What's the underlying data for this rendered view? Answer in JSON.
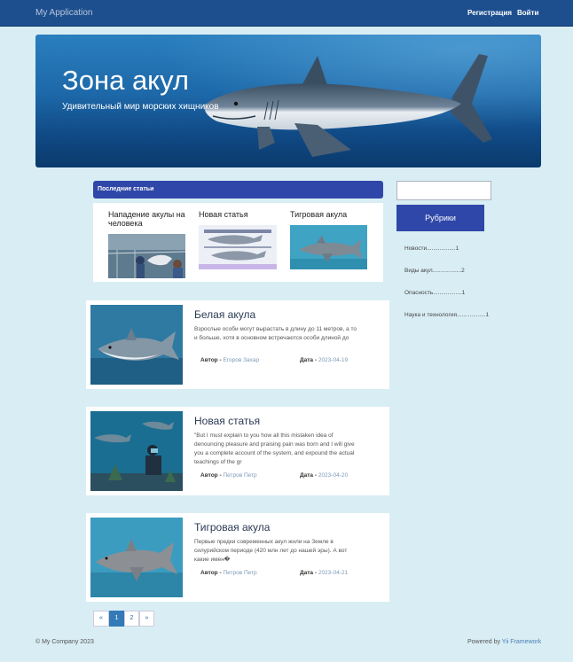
{
  "navbar": {
    "brand": "My Application",
    "register": "Регистрация",
    "login": "Войти"
  },
  "hero": {
    "title": "Зона акул",
    "subtitle": "Удивительный мир морских хищников"
  },
  "latest": {
    "header": "Последние статьи",
    "items": [
      {
        "title": "Нападение акулы на человека"
      },
      {
        "title": "Новая статья"
      },
      {
        "title": "Тигровая акула"
      }
    ]
  },
  "articles": [
    {
      "title": "Белая акула",
      "excerpt": "Взрослые особи могут вырастать в длину до 11 метров, а то и больше, хотя в основном встречаются особи длиной до",
      "author_label": "Автор -",
      "author": "Егоров Захар",
      "date_label": "Дата -",
      "date": "2023-04-19"
    },
    {
      "title": "Новая статья",
      "excerpt": "\"But I must explain to you how all this mistaken idea of denouncing pleasure and praising pain was born and I will give you a complete account of the system, and expound the actual teachings of the gr",
      "author_label": "Автор -",
      "author": "Петров Петр",
      "date_label": "Дата -",
      "date": "2023-04-20"
    },
    {
      "title": "Тигровая акула",
      "excerpt": "Первые предки современных акул жили на Земле в силурийском периоде (420 млн лет до нашей эры). А вот какие имен�",
      "author_label": "Автор -",
      "author": "Петров Петр",
      "date_label": "Дата -",
      "date": "2023-04-21"
    }
  ],
  "sidebar": {
    "search_placeholder": "",
    "button": "Рубрики",
    "categories": [
      {
        "label": "Новости..................1"
      },
      {
        "label": "Виды акул..................2"
      },
      {
        "label": "Опасность..................1"
      },
      {
        "label": "Наука и технология..................1"
      }
    ]
  },
  "pagination": {
    "prev": "«",
    "pages": [
      "1",
      "2"
    ],
    "next": "»",
    "current": "1"
  },
  "footer": {
    "left": "© My Company 2023",
    "powered": "Powered by",
    "framework": "Yii Framework"
  }
}
